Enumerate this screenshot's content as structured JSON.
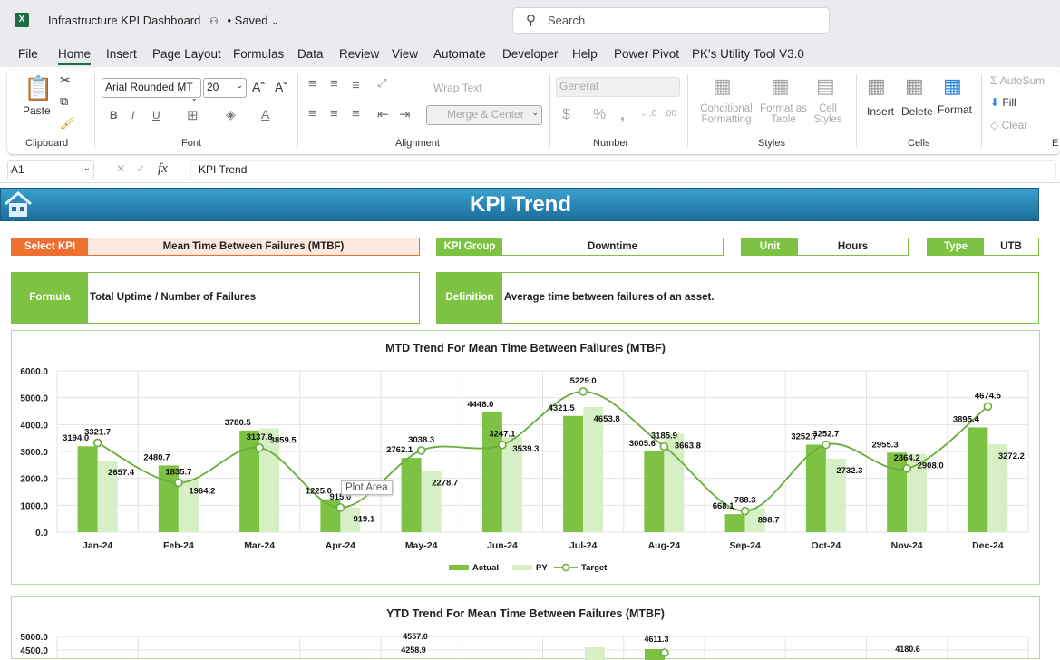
{
  "app": {
    "title": "Infrastructure KPI Dashboard",
    "saved": "• Saved",
    "search_placeholder": "Search"
  },
  "menu": [
    "File",
    "Home",
    "Insert",
    "Page Layout",
    "Formulas",
    "Data",
    "Review",
    "View",
    "Automate",
    "Developer",
    "Help",
    "Power Pivot",
    "PK's Utility Tool V3.0"
  ],
  "ribbon": {
    "clipboard": {
      "paste": "Paste",
      "group": "Clipboard"
    },
    "font": {
      "name": "Arial Rounded MT",
      "size": "20",
      "group": "Font"
    },
    "alignment": {
      "wrap": "Wrap Text",
      "merge": "Merge & Center",
      "group": "Alignment"
    },
    "number": {
      "format": "General",
      "group": "Number"
    },
    "styles": {
      "conditional": "Conditional Formatting",
      "format_table": "Format as Table",
      "cell_styles": "Cell Styles",
      "group": "Styles"
    },
    "cells": {
      "insert": "Insert",
      "delete": "Delete",
      "format": "Format",
      "group": "Cells"
    },
    "editing": {
      "autosum": "AutoSum",
      "fill": "Fill",
      "clear": "Clear",
      "group": "E"
    }
  },
  "formula_bar": {
    "cell_ref": "A1",
    "content": "KPI Trend"
  },
  "dashboard": {
    "title": "KPI Trend",
    "select_kpi_label": "Select KPI",
    "select_kpi_value": "Mean Time Between Failures (MTBF)",
    "kpi_group_label": "KPI Group",
    "kpi_group_value": "Downtime",
    "unit_label": "Unit",
    "unit_value": "Hours",
    "type_label": "Type",
    "type_value": "UTB",
    "formula_label": "Formula",
    "formula_value": "Total Uptime / Number of Failures",
    "definition_label": "Definition",
    "definition_value": "Average time between failures of an asset.",
    "tooltip": "Plot Area"
  },
  "colors": {
    "accent_green": "#7dc243",
    "light_green": "#d6efc4",
    "orange": "#ed7031",
    "banner_blue": "#2383b6",
    "target_line": "#6aab3c"
  },
  "chart_data": [
    {
      "type": "bar",
      "title": "MTD Trend For Mean Time Between Failures (MTBF)",
      "categories": [
        "Jan-24",
        "Feb-24",
        "Mar-24",
        "Apr-24",
        "May-24",
        "Jun-24",
        "Jul-24",
        "Aug-24",
        "Sep-24",
        "Oct-24",
        "Nov-24",
        "Dec-24"
      ],
      "yticks": [
        "0.0",
        "1000.0",
        "2000.0",
        "3000.0",
        "4000.0",
        "5000.0",
        "6000.0"
      ],
      "ylim": [
        0,
        6000
      ],
      "grid": true,
      "legend": "bottom",
      "series": [
        {
          "name": "Actual",
          "type": "bar",
          "color": "#7dc243",
          "values": [
            3194.0,
            2480.7,
            3780.5,
            1225.0,
            2762.1,
            4448.0,
            4321.5,
            3005.6,
            668.1,
            3252.7,
            2955.3,
            3895.4
          ]
        },
        {
          "name": "PY",
          "type": "bar",
          "color": "#d6efc4",
          "values": [
            2657.4,
            1964.2,
            3859.5,
            919.1,
            2278.7,
            3539.3,
            4653.8,
            3663.8,
            898.7,
            2732.3,
            2908.0,
            3272.2
          ]
        },
        {
          "name": "Target",
          "type": "line",
          "color": "#6aab3c",
          "values": [
            3321.7,
            1835.7,
            3137.8,
            915.0,
            3038.3,
            3247.1,
            5229.0,
            3185.9,
            788.3,
            3252.7,
            2364.2,
            4674.5
          ]
        }
      ]
    },
    {
      "type": "bar",
      "title": "YTD Trend For Mean Time Between Failures (MTBF)",
      "yticks": [
        "5000.0",
        "4500.0"
      ],
      "visible_labels": [
        "4557.0",
        "4258.9",
        "4611.3",
        "4180.6"
      ]
    }
  ]
}
